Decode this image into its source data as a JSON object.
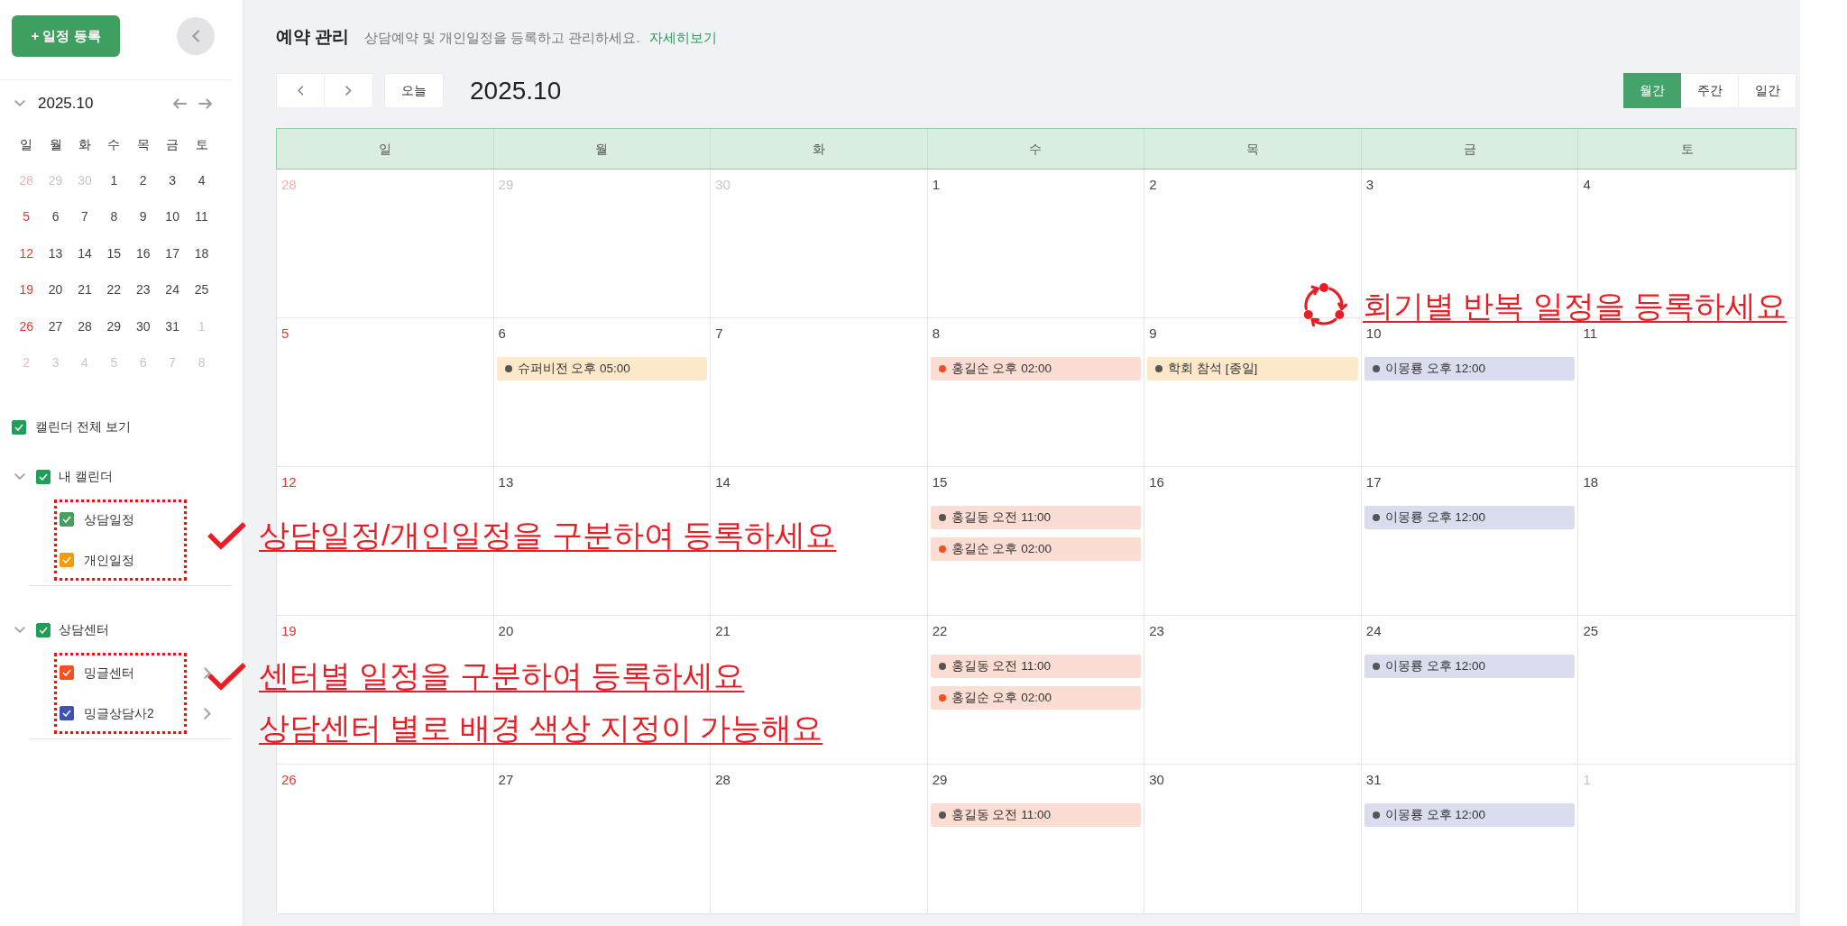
{
  "sidebar": {
    "add_button": "+ 일정 등록",
    "mini_calendar": {
      "title": "2025.10",
      "expanded": true,
      "weekdays": [
        "일",
        "월",
        "화",
        "수",
        "목",
        "금",
        "토"
      ],
      "weeks": [
        [
          {
            "day": "28",
            "muted": true
          },
          {
            "day": "29",
            "muted": true
          },
          {
            "day": "30",
            "muted": true
          },
          {
            "day": "1",
            "muted": false
          },
          {
            "day": "2",
            "muted": false
          },
          {
            "day": "3",
            "muted": false
          },
          {
            "day": "4",
            "muted": false
          }
        ],
        [
          {
            "day": "5",
            "muted": false
          },
          {
            "day": "6",
            "muted": false
          },
          {
            "day": "7",
            "muted": false
          },
          {
            "day": "8",
            "muted": false
          },
          {
            "day": "9",
            "muted": false
          },
          {
            "day": "10",
            "muted": false
          },
          {
            "day": "11",
            "muted": false
          }
        ],
        [
          {
            "day": "12",
            "muted": false
          },
          {
            "day": "13",
            "muted": false
          },
          {
            "day": "14",
            "muted": false
          },
          {
            "day": "15",
            "muted": false
          },
          {
            "day": "16",
            "muted": false
          },
          {
            "day": "17",
            "muted": false
          },
          {
            "day": "18",
            "muted": false
          }
        ],
        [
          {
            "day": "19",
            "muted": false
          },
          {
            "day": "20",
            "muted": false
          },
          {
            "day": "21",
            "muted": false
          },
          {
            "day": "22",
            "muted": false
          },
          {
            "day": "23",
            "muted": false
          },
          {
            "day": "24",
            "muted": false
          },
          {
            "day": "25",
            "muted": false
          }
        ],
        [
          {
            "day": "26",
            "muted": false
          },
          {
            "day": "27",
            "muted": false
          },
          {
            "day": "28",
            "muted": false
          },
          {
            "day": "29",
            "muted": false
          },
          {
            "day": "30",
            "muted": false
          },
          {
            "day": "31",
            "muted": false
          },
          {
            "day": "1",
            "muted": true
          }
        ],
        [
          {
            "day": "2",
            "muted": true
          },
          {
            "day": "3",
            "muted": true
          },
          {
            "day": "4",
            "muted": true
          },
          {
            "day": "5",
            "muted": true
          },
          {
            "day": "6",
            "muted": true
          },
          {
            "day": "7",
            "muted": true
          },
          {
            "day": "8",
            "muted": true
          }
        ]
      ]
    },
    "show_all": {
      "label": "캘린더 전체 보기",
      "checked": true,
      "color": "#1e9e57"
    },
    "groups": [
      {
        "label": "내 캘린더",
        "checked": true,
        "color": "#1e9e57",
        "expanded": true,
        "highlighted": true,
        "children": [
          {
            "label": "상담일정",
            "checked": true,
            "color": "#43a05f",
            "submenu": false
          },
          {
            "label": "개인일정",
            "checked": true,
            "color": "#f29b0e",
            "submenu": false
          }
        ]
      },
      {
        "label": "상담센터",
        "checked": true,
        "color": "#1e9e57",
        "expanded": true,
        "highlighted": true,
        "children": [
          {
            "label": "밍글센터",
            "checked": true,
            "color": "#f4511e",
            "submenu": true
          },
          {
            "label": "밍글상담사2",
            "checked": true,
            "color": "#3f51b5",
            "submenu": true
          }
        ]
      }
    ]
  },
  "header": {
    "title": "예약 관리",
    "subtitle": "상담예약 및 개인일정을 등록하고 관리하세요.",
    "link": "자세히보기"
  },
  "toolbar": {
    "today_button": "오늘",
    "period": "2025.10",
    "views": [
      {
        "label": "월간",
        "selected": true
      },
      {
        "label": "주간",
        "selected": false
      },
      {
        "label": "일간",
        "selected": false
      }
    ]
  },
  "calendar": {
    "weekdays": [
      "일",
      "월",
      "화",
      "수",
      "목",
      "금",
      "토"
    ],
    "weeks": [
      [
        {
          "day": "28",
          "muted": true
        },
        {
          "day": "29",
          "muted": true
        },
        {
          "day": "30",
          "muted": true
        },
        {
          "day": "1",
          "muted": false
        },
        {
          "day": "2",
          "muted": false
        },
        {
          "day": "3",
          "muted": false
        },
        {
          "day": "4",
          "muted": false
        }
      ],
      [
        {
          "day": "5",
          "muted": false
        },
        {
          "day": "6",
          "muted": false,
          "events": [
            {
              "label": "슈퍼비전 오후 05:00",
              "color": "#fde9c9",
              "dot": {
                "color": "#555555"
              }
            }
          ]
        },
        {
          "day": "7",
          "muted": false
        },
        {
          "day": "8",
          "muted": false,
          "events": [
            {
              "label": "홍길순 오후 02:00",
              "color": "#fbddd3",
              "dot": {
                "color": "#f4511e"
              }
            }
          ]
        },
        {
          "day": "9",
          "muted": false,
          "events": [
            {
              "label": "학회 참석 [종일]",
              "color": "#fde9c9",
              "dot": {
                "color": "#555555"
              }
            }
          ]
        },
        {
          "day": "10",
          "muted": false,
          "events": [
            {
              "label": "이몽룡 오후 12:00",
              "color": "#dadded",
              "dot": {
                "color": "#555555"
              }
            }
          ]
        },
        {
          "day": "11",
          "muted": false
        }
      ],
      [
        {
          "day": "12",
          "muted": false
        },
        {
          "day": "13",
          "muted": false
        },
        {
          "day": "14",
          "muted": false
        },
        {
          "day": "15",
          "muted": false,
          "events": [
            {
              "label": "홍길동 오전 11:00",
              "color": "#fbddd3",
              "dot": {
                "color": "#555555"
              }
            },
            {
              "label": "홍길순 오후 02:00",
              "color": "#fbddd3",
              "dot": {
                "color": "#f4511e"
              }
            }
          ]
        },
        {
          "day": "16",
          "muted": false
        },
        {
          "day": "17",
          "muted": false,
          "events": [
            {
              "label": "이몽룡 오후 12:00",
              "color": "#dadded",
              "dot": {
                "color": "#555555"
              }
            }
          ]
        },
        {
          "day": "18",
          "muted": false
        }
      ],
      [
        {
          "day": "19",
          "muted": false
        },
        {
          "day": "20",
          "muted": false
        },
        {
          "day": "21",
          "muted": false
        },
        {
          "day": "22",
          "muted": false,
          "events": [
            {
              "label": "홍길동 오전 11:00",
              "color": "#fbddd3",
              "dot": {
                "color": "#555555"
              }
            },
            {
              "label": "홍길순 오후 02:00",
              "color": "#fbddd3",
              "dot": {
                "color": "#f4511e"
              }
            }
          ]
        },
        {
          "day": "23",
          "muted": false
        },
        {
          "day": "24",
          "muted": false,
          "events": [
            {
              "label": "이몽룡 오후 12:00",
              "color": "#dadded",
              "dot": {
                "color": "#555555"
              }
            }
          ]
        },
        {
          "day": "25",
          "muted": false
        }
      ],
      [
        {
          "day": "26",
          "muted": false
        },
        {
          "day": "27",
          "muted": false
        },
        {
          "day": "28",
          "muted": false
        },
        {
          "day": "29",
          "muted": false,
          "events": [
            {
              "label": "홍길동 오전 11:00",
              "color": "#fbddd3",
              "dot": {
                "color": "#555555"
              }
            }
          ]
        },
        {
          "day": "30",
          "muted": false
        },
        {
          "day": "31",
          "muted": false,
          "events": [
            {
              "label": "이몽룡 오후 12:00",
              "color": "#dadded",
              "dot": {
                "color": "#555555"
              }
            }
          ]
        },
        {
          "day": "1",
          "muted": true
        }
      ]
    ]
  },
  "annotations": [
    {
      "kind": "check",
      "lines": [
        "상담일정/개인일정을 구분하여 등록하세요"
      ]
    },
    {
      "kind": "check",
      "lines": [
        "센터별 일정을 구분하여 등록하세요",
        "상담센터 별로 배경 색상 지정이 가능해요"
      ]
    },
    {
      "kind": "repeat",
      "lines": [
        "회기별 반복 일정을 등록하세요"
      ]
    }
  ]
}
